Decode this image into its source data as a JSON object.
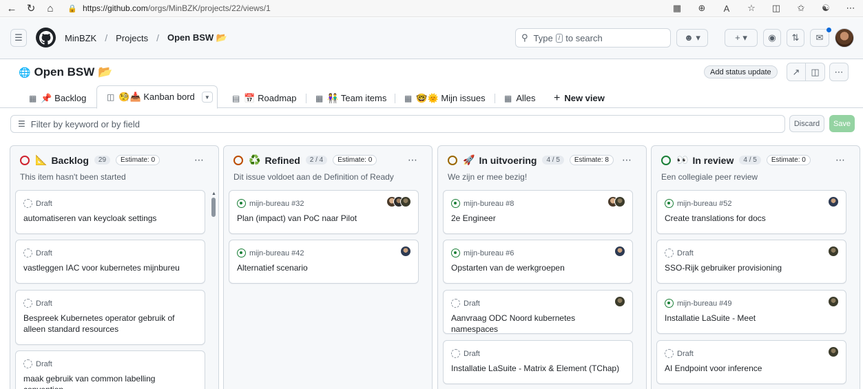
{
  "browser": {
    "url_host": "https://github.com",
    "url_path": "/orgs/MinBZK/projects/22/views/1"
  },
  "header": {
    "org": "MinBZK",
    "projects": "Projects",
    "project": "Open BSW 📂",
    "search_prefix": "Type",
    "search_key": "/",
    "search_suffix": "to search"
  },
  "project": {
    "title": "Open BSW 📂",
    "status_button": "Add status update"
  },
  "tabs": [
    {
      "label": "📌 Backlog"
    },
    {
      "label": "🧐📥 Kanban bord"
    },
    {
      "label": "📅 Roadmap"
    },
    {
      "label": "👫 Team items"
    },
    {
      "label": "🤓🌞 Mijn issues"
    },
    {
      "label": "Alles"
    },
    {
      "label": "New view"
    }
  ],
  "filter": {
    "placeholder": "Filter by keyword or by field",
    "discard": "Discard",
    "save": "Save"
  },
  "colors": {
    "backlog": "#cf222e",
    "refined": "#bc4c00",
    "in_progress": "#9a6700",
    "in_review": "#1a7f37"
  },
  "columns": [
    {
      "emoji": "📐",
      "name": "Backlog",
      "count": "29",
      "estimate": "Estimate: 0",
      "description": "This item hasn't been started",
      "cards": [
        {
          "meta": "Draft",
          "title": "automatiseren van keycloak settings"
        },
        {
          "meta": "Draft",
          "title": "vastleggen IAC voor kubernetes mijnbureu"
        },
        {
          "meta": "Draft",
          "title": "Bespreek Kubernetes operator gebruik of alleen standard resources"
        },
        {
          "meta": "Draft",
          "title": "maak gebruik van common labelling convention"
        }
      ]
    },
    {
      "emoji": "♻️",
      "name": "Refined",
      "count": "2 / 4",
      "estimate": "Estimate: 0",
      "description": "Dit issue voldoet aan de Definition of Ready",
      "cards": [
        {
          "meta": "mijn-bureau #32",
          "title": "Plan (impact) van PoC naar Pilot"
        },
        {
          "meta": "mijn-bureau #42",
          "title": "Alternatief scenario"
        }
      ]
    },
    {
      "emoji": "🚀",
      "name": "In uitvoering",
      "count": "4 / 5",
      "estimate": "Estimate: 8",
      "description": "We zijn er mee bezig!",
      "cards": [
        {
          "meta": "mijn-bureau #8",
          "title": "2e Engineer"
        },
        {
          "meta": "mijn-bureau #6",
          "title": "Opstarten van de werkgroepen"
        },
        {
          "meta": "Draft",
          "title": "Aanvraag ODC Noord kubernetes namespaces"
        },
        {
          "meta": "Draft",
          "title": "Installatie LaSuite - Matrix & Element (TChap)"
        }
      ]
    },
    {
      "emoji": "👀",
      "name": "In review",
      "count": "4 / 5",
      "estimate": "Estimate: 0",
      "description": "Een collegiale peer review",
      "cards": [
        {
          "meta": "mijn-bureau #52",
          "title": "Create translations for docs"
        },
        {
          "meta": "Draft",
          "title": "SSO-Rijk gebruiker provisioning"
        },
        {
          "meta": "mijn-bureau #49",
          "title": "Installatie LaSuite - Meet"
        },
        {
          "meta": "Draft",
          "title": "AI Endpoint voor inference"
        }
      ]
    }
  ]
}
